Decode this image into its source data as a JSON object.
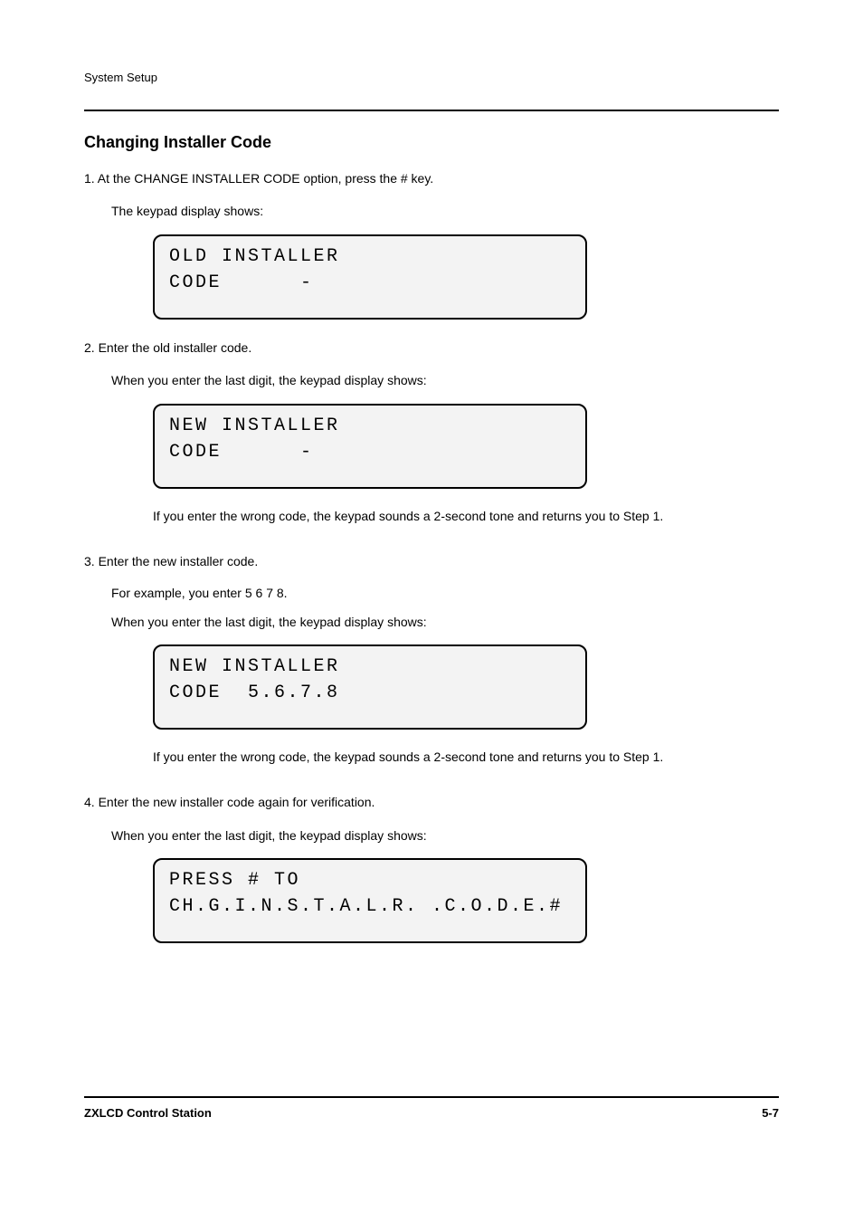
{
  "header": "System Setup",
  "section_title": "Changing Installer Code",
  "steps": {
    "s1": {
      "line": "1. At the CHANGE INSTALLER CODE option, press the # key.",
      "after": "The keypad display shows:",
      "lcd_l1": "OLD INSTALLER",
      "lcd_l2": "CODE      -"
    },
    "s2": {
      "line": "2. Enter the old installer code.",
      "after": "When you enter the last digit, the keypad display shows:",
      "lcd_l1": "NEW INSTALLER",
      "lcd_l2": "CODE      -"
    },
    "s3": {
      "line": "3. Enter the new installer code.",
      "sub": "For example, you enter 5 6 7 8.",
      "after": "When you enter the last digit, the keypad display shows:",
      "lcd_l1": "NEW INSTALLER",
      "lcd_l2": "CODE  5.6.7.8"
    },
    "s4": {
      "line": "4. Enter the new installer code again for verification.",
      "after": "When you enter the last digit, the keypad display shows:",
      "lcd_l1": "PRESS # TO",
      "lcd_l2": "CH.G.I.N.S.T.A.L.R. .C.O.D.E.#"
    }
  },
  "note": "If you enter the wrong code, the keypad sounds a 2-second tone and returns you to Step 1.",
  "footer_left": "ZXLCD Control Station",
  "footer_right": "5-7"
}
